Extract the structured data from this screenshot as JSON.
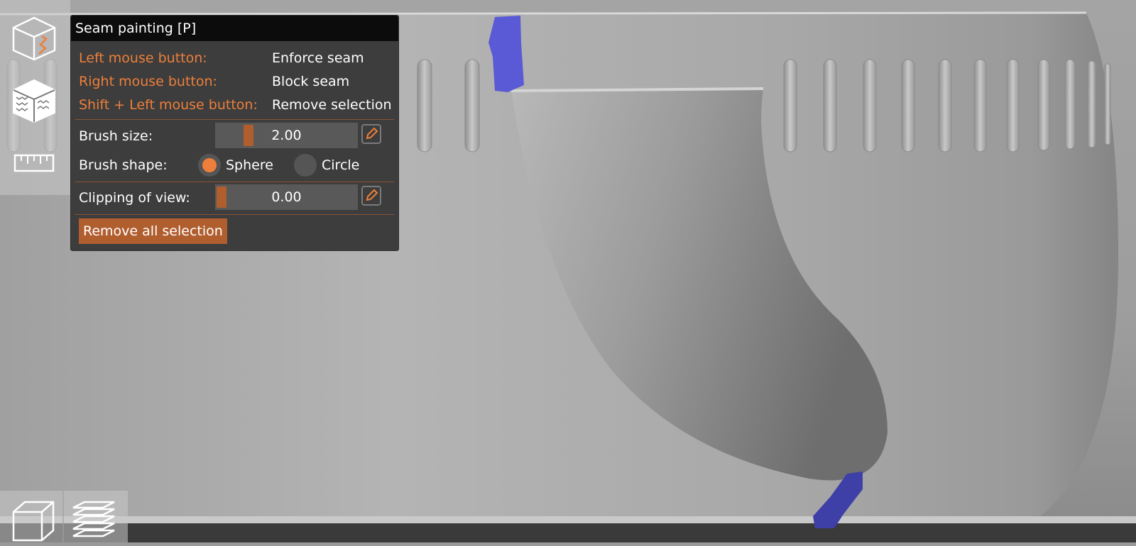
{
  "panel": {
    "title": "Seam painting [P]",
    "shortcuts": [
      {
        "key": "Left mouse button:",
        "action": "Enforce seam"
      },
      {
        "key": "Right mouse button:",
        "action": "Block seam"
      },
      {
        "key": "Shift + Left mouse button:",
        "action": "Remove selection"
      }
    ],
    "brush_size": {
      "label": "Brush size:",
      "value": "2.00"
    },
    "brush_shape": {
      "label": "Brush shape:",
      "options": [
        "Sphere",
        "Circle"
      ],
      "selected": "Sphere"
    },
    "clipping": {
      "label": "Clipping of view:",
      "value": "0.00"
    },
    "remove_all_label": "Remove all selection"
  },
  "toolbar_left": {
    "tools": [
      "seam-painting-icon",
      "fuzzy-skin-icon",
      "measure-ruler-icon"
    ]
  },
  "toolbar_bottom": {
    "tools": [
      "3d-view-icon",
      "layers-preview-icon"
    ]
  },
  "colors": {
    "accent": "#ed7f3a",
    "slider_grab": "#b15e2f",
    "panel_bg": "#3d3d3d",
    "seam_paint": "#5a5ad6"
  }
}
